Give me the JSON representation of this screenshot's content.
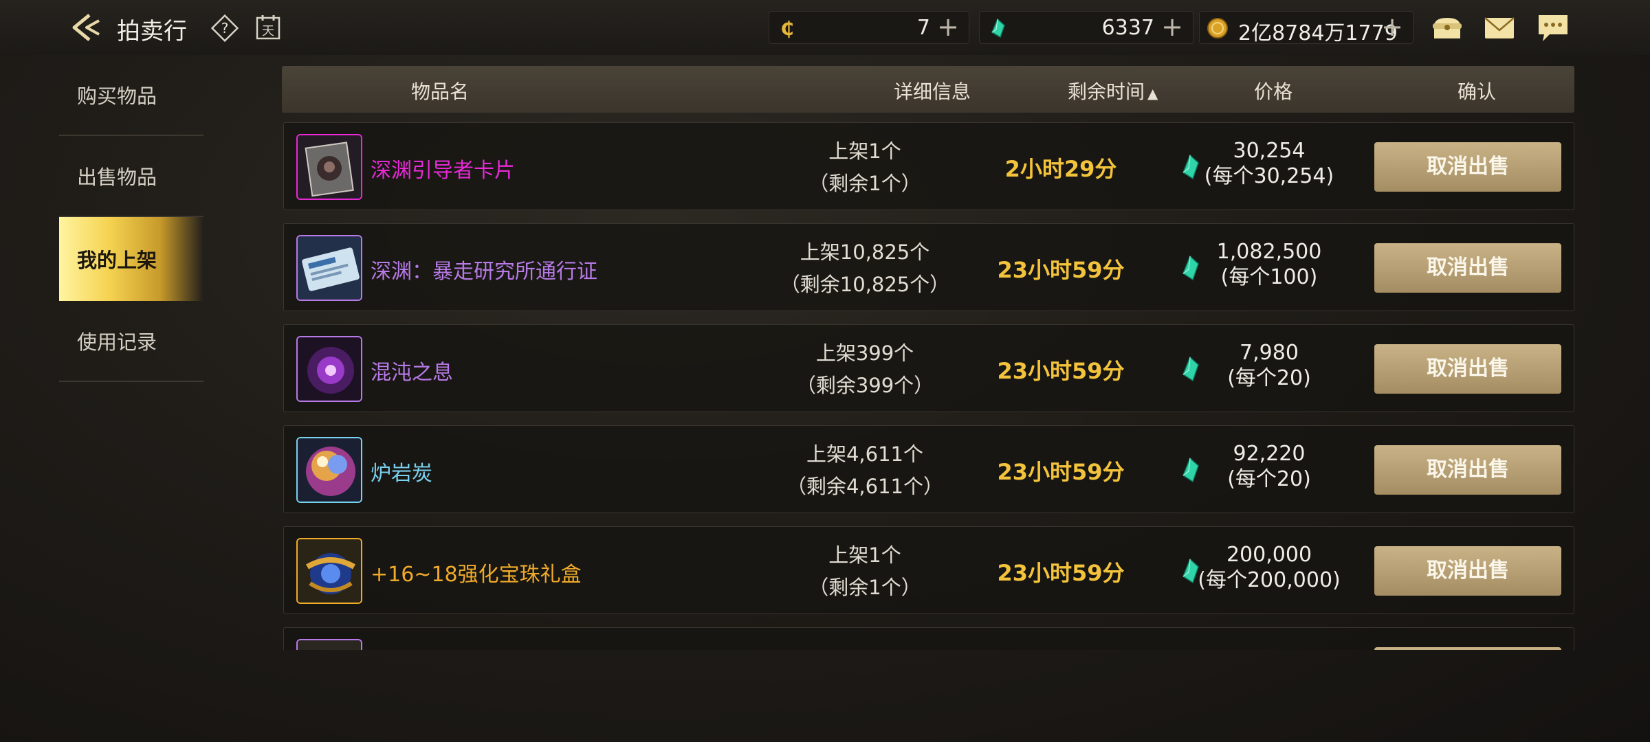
{
  "header": {
    "title": "拍卖行",
    "back_icon": "back-arrow-icon",
    "help_icon": "help-icon",
    "calendar_icon": "calendar-icon"
  },
  "currencies": [
    {
      "icon": "c-coin-icon",
      "value": "7",
      "plus": "+"
    },
    {
      "icon": "green-gem-icon",
      "value": "6337",
      "plus": "+"
    },
    {
      "icon": "gold-coin-icon",
      "value": "2亿8784万1779",
      "plus": "+"
    }
  ],
  "top_icons": [
    "treasure-bag-icon",
    "mail-icon",
    "chat-icon"
  ],
  "sidebar": {
    "items": [
      {
        "label": "购买物品"
      },
      {
        "label": "出售物品"
      },
      {
        "label": "我的上架"
      },
      {
        "label": "使用记录"
      }
    ]
  },
  "table": {
    "headers": {
      "name": "物品名",
      "detail": "详细信息",
      "time": "剩余时间",
      "sort": "▲",
      "price": "价格",
      "confirm": "确认"
    },
    "rows": [
      {
        "name": "深渊引导者卡片",
        "name_color": "#e62ad6",
        "detail1": "上架1个",
        "detail2": "（剩余1个）",
        "remain": "2小时29分",
        "price1": "30,254",
        "price2": "(每个30,254)",
        "button": "取消出售",
        "icon": "card-item-icon"
      },
      {
        "name": "深渊：暴走研究所通行证",
        "name_color": "#b77ae6",
        "detail1": "上架10,825个",
        "detail2": "（剩余10,825个）",
        "remain": "23小时59分",
        "price1": "1,082,500",
        "price2": "(每个100)",
        "button": "取消出售",
        "icon": "ticket-item-icon"
      },
      {
        "name": "混沌之息",
        "name_color": "#b77ae6",
        "detail1": "上架399个",
        "detail2": "（剩余399个）",
        "remain": "23小时59分",
        "price1": "7,980",
        "price2": "(每个20)",
        "button": "取消出售",
        "icon": "chaos-breath-icon"
      },
      {
        "name": "炉岩炭",
        "name_color": "#7ad0ef",
        "detail1": "上架4,611个",
        "detail2": "（剩余4,611个）",
        "remain": "23小时59分",
        "price1": "92,220",
        "price2": "(每个20)",
        "button": "取消出售",
        "icon": "lava-coal-icon"
      },
      {
        "name": "+16~18强化宝珠礼盒",
        "name_color": "#f0aa2a",
        "detail1": "上架1个",
        "detail2": "（剩余1个）",
        "remain": "23小时59分",
        "price1": "200,000",
        "price2": "(每个200,000)",
        "button": "取消出售",
        "icon": "orb-giftbox-icon"
      },
      {
        "name": "",
        "name_color": "#b77ae6",
        "detail1": "",
        "detail2": "",
        "remain": "",
        "price1": "",
        "price2": "",
        "button": "",
        "icon": "partial-item-icon"
      }
    ]
  },
  "colors": {
    "accent_gold": "#f3c33c",
    "gem": "#2fd4a8",
    "button": "#b59d70"
  }
}
